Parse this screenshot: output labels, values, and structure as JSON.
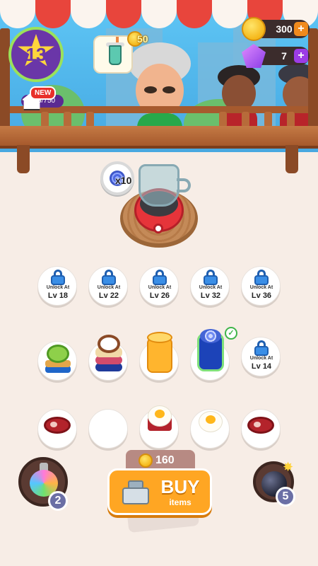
{
  "hud": {
    "level": "13",
    "xp": "393/750",
    "coins": "300",
    "gems": "7",
    "new_badge": "NEW"
  },
  "order": {
    "reward": "50",
    "item_icon": "drink-cup-icon"
  },
  "station": {
    "ingredient_count": "x10"
  },
  "locked_slots": [
    {
      "unlock_text": "Unlock At",
      "level": "Lv 18"
    },
    {
      "unlock_text": "Unlock At",
      "level": "Lv 22"
    },
    {
      "unlock_text": "Unlock At",
      "level": "Lv 26"
    },
    {
      "unlock_text": "Unlock At",
      "level": "Lv 32"
    },
    {
      "unlock_text": "Unlock At",
      "level": "Lv 36"
    },
    {
      "unlock_text": "Unlock At",
      "level": "Lv 14"
    }
  ],
  "powerups": {
    "potion_count": "2",
    "bomb_count": "5"
  },
  "buy": {
    "price": "160",
    "label": "BUY",
    "sub_label": "items"
  },
  "colors": {
    "awning_red": "#e8453c",
    "button_orange": "#ffa623",
    "level_purple": "#6a36a8",
    "lock_blue": "#3a8ee6"
  }
}
